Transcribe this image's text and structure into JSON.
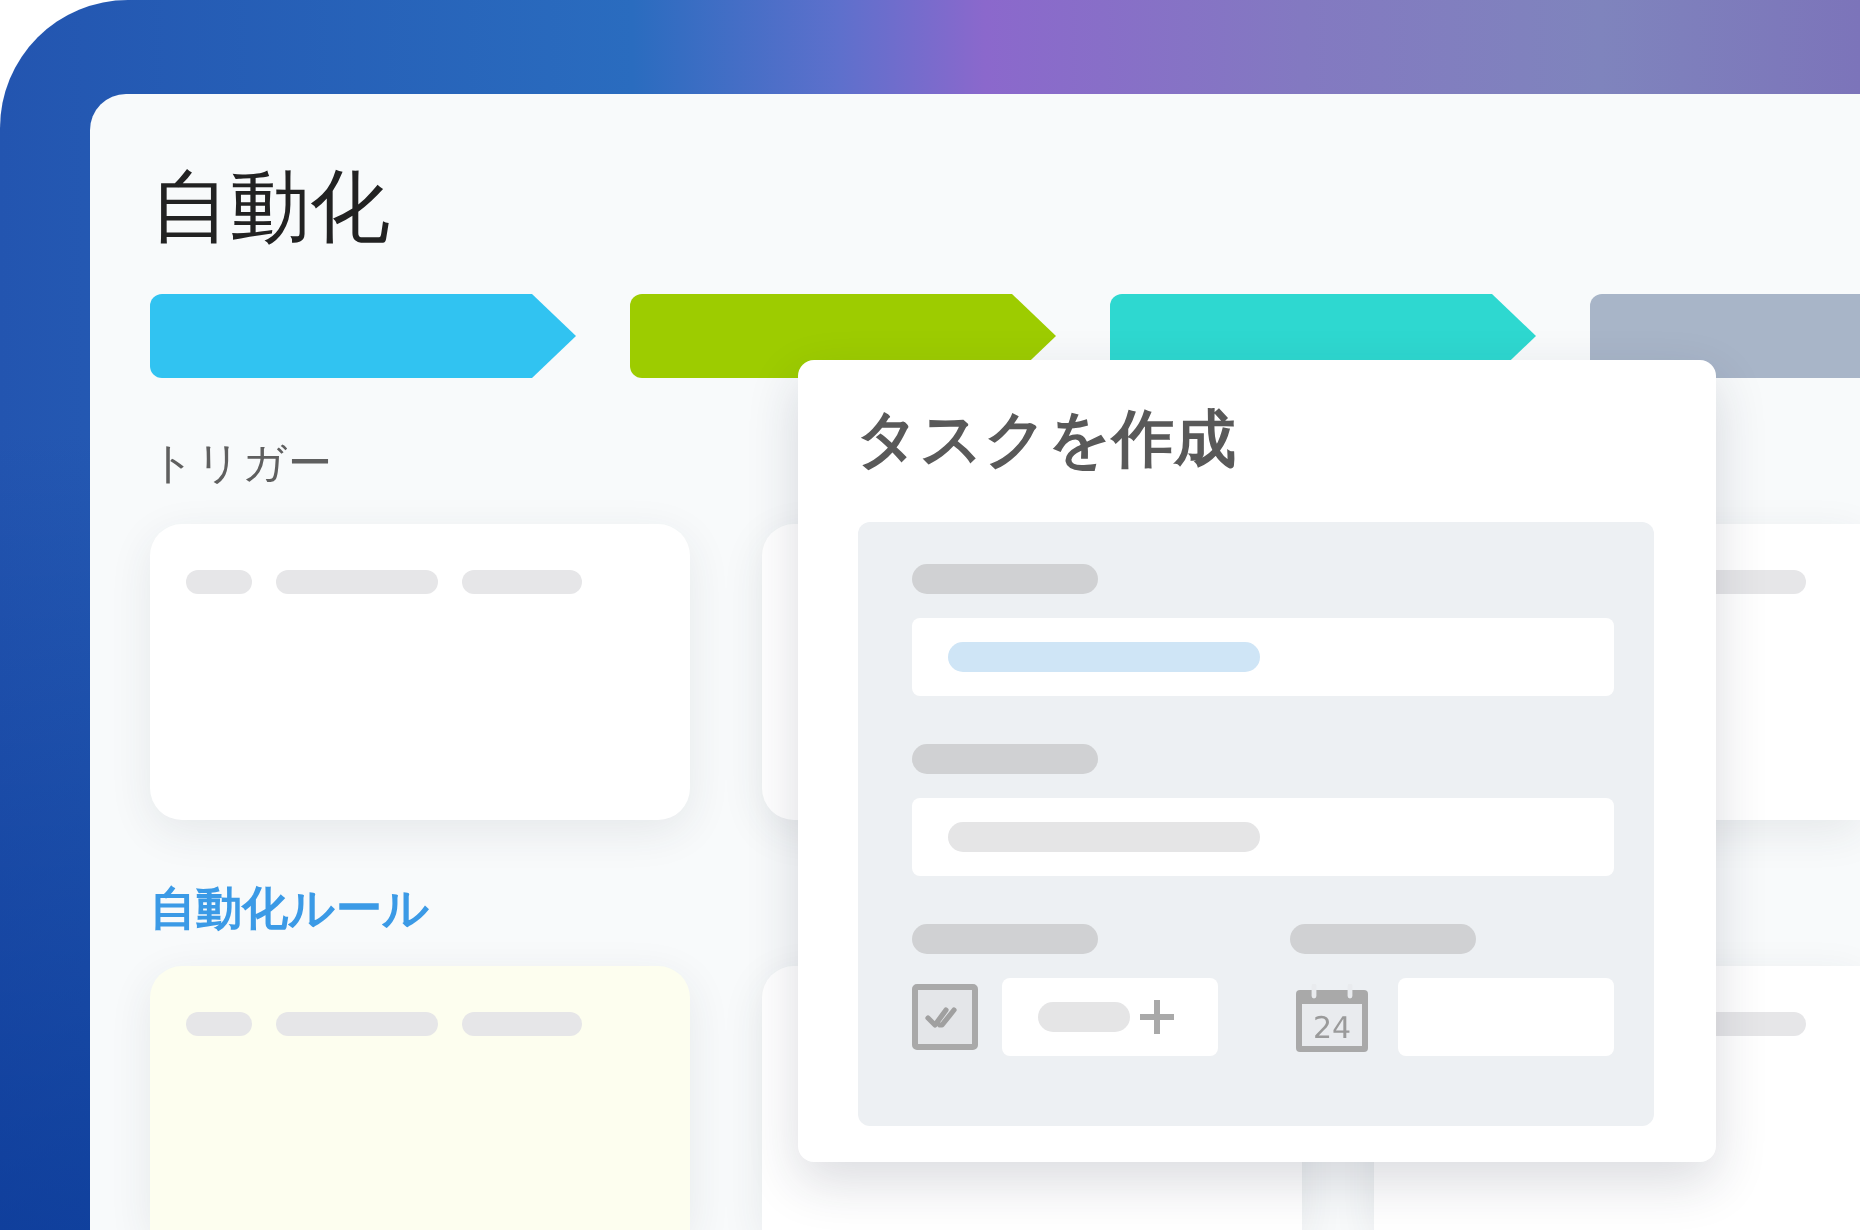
{
  "page": {
    "title": "自動化"
  },
  "stages": [
    {
      "color": "#31c3f1"
    },
    {
      "color": "#9dcc00"
    },
    {
      "color": "#2ed8d0"
    },
    {
      "color": "#a8b5c8"
    }
  ],
  "sections": [
    {
      "kind": "trigger",
      "label": "トリガー",
      "cards": [
        {
          "color": "#ffffff"
        },
        {
          "color": "#ffffff"
        },
        {
          "color": "#ffffff"
        }
      ]
    },
    {
      "kind": "rule",
      "label": "自動化ルール",
      "cards": [
        {
          "color": "#fdfeef"
        },
        {
          "color": "#ffffff"
        },
        {
          "color": "#ffffff"
        }
      ]
    }
  ],
  "dialog": {
    "title": "タスクを作成",
    "calendar_day": "24"
  }
}
